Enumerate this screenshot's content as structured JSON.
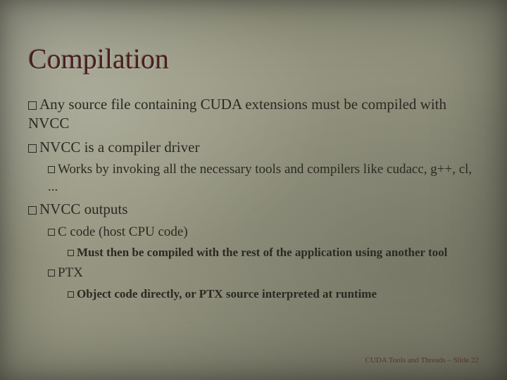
{
  "title": "Compilation",
  "bullets": {
    "b1": "Any source file containing CUDA extensions must be compiled with NVCC",
    "b2": "NVCC is a compiler driver",
    "b2_1": "Works by invoking all the necessary tools and compilers like cudacc, g++, cl, ...",
    "b3": "NVCC outputs",
    "b3_1": "C code (host CPU code)",
    "b3_1_1": "Must then be compiled with the rest of the application using another tool",
    "b3_2": "PTX",
    "b3_2_1": "Object code directly, or PTX source interpreted at runtime"
  },
  "footer": {
    "text": "CUDA Tools and Threads – Slide",
    "page": "22"
  }
}
